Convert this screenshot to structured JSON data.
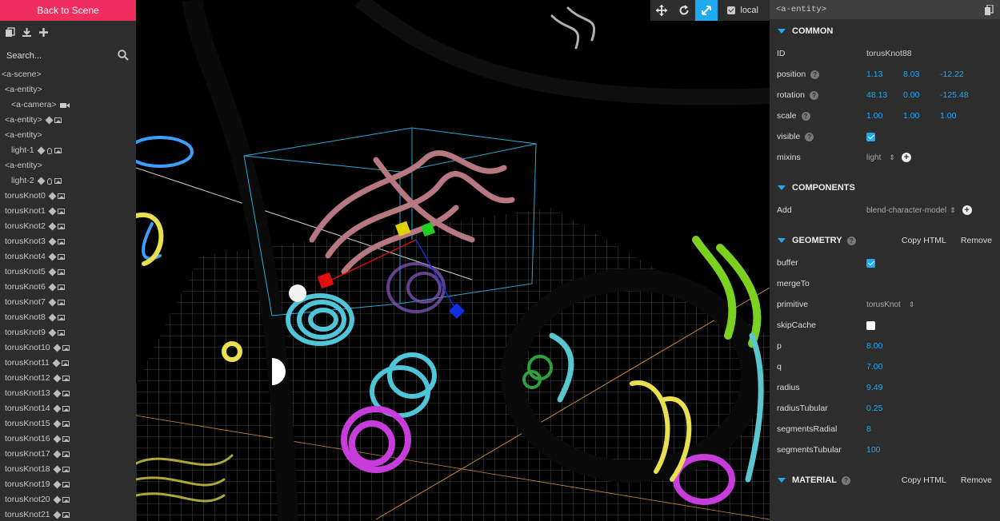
{
  "left_panel": {
    "back_button": "Back to Scene",
    "search_placeholder": "Search...",
    "toolbar_icons": [
      "copy-icon",
      "download-icon",
      "add-icon"
    ],
    "outliner": [
      {
        "label": "<a-scene>",
        "indent": 0,
        "icons": []
      },
      {
        "label": "<a-entity>",
        "indent": 1,
        "icons": []
      },
      {
        "label": "<a-camera>",
        "indent": 2,
        "icons": [
          "camera"
        ]
      },
      {
        "label": "<a-entity>",
        "indent": 1,
        "icons": [
          "model",
          "image"
        ]
      },
      {
        "label": "<a-entity>",
        "indent": 1,
        "icons": []
      },
      {
        "label": "light-1",
        "indent": 2,
        "icons": [
          "model",
          "light",
          "image"
        ]
      },
      {
        "label": "<a-entity>",
        "indent": 1,
        "icons": []
      },
      {
        "label": "light-2",
        "indent": 2,
        "icons": [
          "model",
          "light",
          "image"
        ]
      },
      {
        "label": "torusKnot0",
        "indent": 1,
        "icons": [
          "model",
          "image"
        ]
      },
      {
        "label": "torusKnot1",
        "indent": 1,
        "icons": [
          "model",
          "image"
        ]
      },
      {
        "label": "torusKnot2",
        "indent": 1,
        "icons": [
          "model",
          "image"
        ]
      },
      {
        "label": "torusKnot3",
        "indent": 1,
        "icons": [
          "model",
          "image"
        ]
      },
      {
        "label": "torusKnot4",
        "indent": 1,
        "icons": [
          "model",
          "image"
        ]
      },
      {
        "label": "torusKnot5",
        "indent": 1,
        "icons": [
          "model",
          "image"
        ]
      },
      {
        "label": "torusKnot6",
        "indent": 1,
        "icons": [
          "model",
          "image"
        ]
      },
      {
        "label": "torusKnot7",
        "indent": 1,
        "icons": [
          "model",
          "image"
        ]
      },
      {
        "label": "torusKnot8",
        "indent": 1,
        "icons": [
          "model",
          "image"
        ]
      },
      {
        "label": "torusKnot9",
        "indent": 1,
        "icons": [
          "model",
          "image"
        ]
      },
      {
        "label": "torusKnot10",
        "indent": 1,
        "icons": [
          "model",
          "image"
        ]
      },
      {
        "label": "torusKnot11",
        "indent": 1,
        "icons": [
          "model",
          "image"
        ]
      },
      {
        "label": "torusKnot12",
        "indent": 1,
        "icons": [
          "model",
          "image"
        ]
      },
      {
        "label": "torusKnot13",
        "indent": 1,
        "icons": [
          "model",
          "image"
        ]
      },
      {
        "label": "torusKnot14",
        "indent": 1,
        "icons": [
          "model",
          "image"
        ]
      },
      {
        "label": "torusKnot15",
        "indent": 1,
        "icons": [
          "model",
          "image"
        ]
      },
      {
        "label": "torusKnot16",
        "indent": 1,
        "icons": [
          "model",
          "image"
        ]
      },
      {
        "label": "torusKnot17",
        "indent": 1,
        "icons": [
          "model",
          "image"
        ]
      },
      {
        "label": "torusKnot18",
        "indent": 1,
        "icons": [
          "model",
          "image"
        ]
      },
      {
        "label": "torusKnot19",
        "indent": 1,
        "icons": [
          "model",
          "image"
        ]
      },
      {
        "label": "torusKnot20",
        "indent": 1,
        "icons": [
          "model",
          "image"
        ]
      },
      {
        "label": "torusKnot21",
        "indent": 1,
        "icons": [
          "model",
          "image"
        ]
      }
    ]
  },
  "viewport": {
    "tools": [
      "translate-icon",
      "rotate-icon",
      "scale-icon"
    ],
    "active_tool": "scale-icon",
    "local_label": "local",
    "local_checked": true
  },
  "right_panel": {
    "entity_tag": "<a-entity>",
    "common": {
      "title": "COMMON",
      "id_label": "ID",
      "id_value": "torusKnot88",
      "position_label": "position",
      "position": [
        "1.13",
        "8.03",
        "-12.22"
      ],
      "rotation_label": "rotation",
      "rotation": [
        "48.13",
        "0.00",
        "-125.48"
      ],
      "scale_label": "scale",
      "scale": [
        "1.00",
        "1.00",
        "1.00"
      ],
      "visible_label": "visible",
      "visible": true,
      "mixins_label": "mixins",
      "mixins_value": "light"
    },
    "components": {
      "title": "COMPONENTS",
      "add_label": "Add",
      "add_value": "blend-character-model"
    },
    "geometry": {
      "title": "GEOMETRY",
      "copy_html": "Copy HTML",
      "remove": "Remove",
      "buffer_label": "buffer",
      "buffer": true,
      "mergeTo_label": "mergeTo",
      "primitive_label": "primitive",
      "primitive_value": "torusKnot",
      "skipCache_label": "skipCache",
      "skipCache": false,
      "p_label": "p",
      "p": "8.00",
      "q_label": "q",
      "q": "7.00",
      "radius_label": "radius",
      "radius": "9.49",
      "radiusTubular_label": "radiusTubular",
      "radiusTubular": "0.25",
      "segmentsRadial_label": "segmentsRadial",
      "segmentsRadial": "8",
      "segmentsTubular_label": "segmentsTubular",
      "segmentsTubular": "100"
    },
    "material": {
      "title": "MATERIAL",
      "copy_html": "Copy HTML",
      "remove": "Remove"
    }
  },
  "colors": {
    "accent": "#1faaf2",
    "back_button": "#ef2d5e",
    "panel": "#2d2d2d"
  }
}
